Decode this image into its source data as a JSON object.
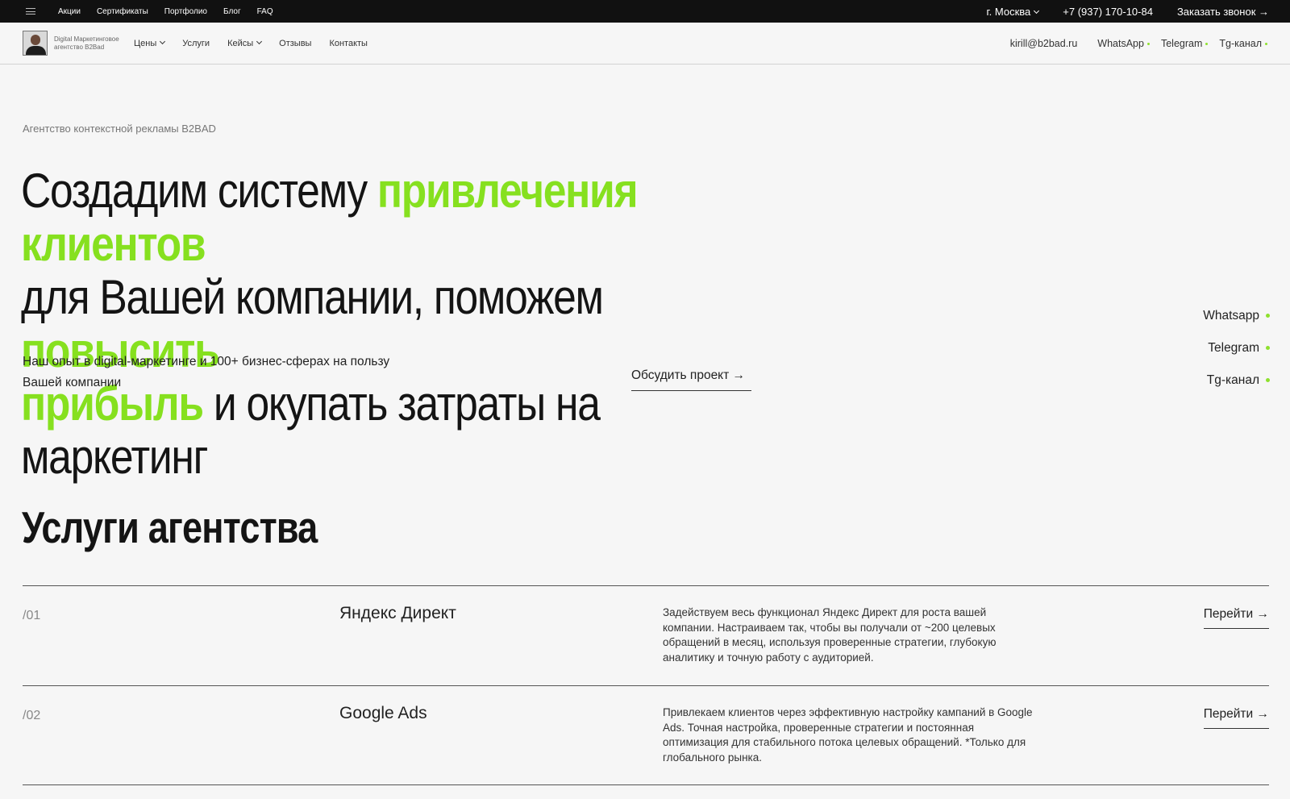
{
  "topbar": {
    "links": [
      "Акции",
      "Сертификаты",
      "Портфолио",
      "Блог",
      "FAQ"
    ],
    "city": "г. Москва",
    "phone": "+7 (937) 170-10-84",
    "callback": "Заказать звонок →"
  },
  "nav": {
    "brand": "Digital Маркетинговое агентство B2Bad",
    "items": [
      "Цены",
      "Услуги",
      "Кейсы",
      "Отзывы",
      "Контакты"
    ],
    "email": "kirill@b2bad.ru",
    "messengers": [
      "WhatsApp",
      "Telegram",
      "Tg-канал"
    ]
  },
  "hero": {
    "kicker": "Агентство контекстной рекламы B2BAD",
    "line1_a": "Создадим систему ",
    "line1_b": "привлечения клиентов",
    "line2_a": "для Вашей компании, поможем ",
    "line2_b": "повысить",
    "line3_a": "прибыль",
    "line3_b": " и окупать затраты на маркетинг",
    "sub1": "Наш опыт в digital-маркетинге и 100+ бизнес-сферах на пользу",
    "sub2": "Вашей компании",
    "cta": "Обсудить проект →"
  },
  "side": [
    "Whatsapp",
    "Telegram",
    "Tg-канал"
  ],
  "services": {
    "title": "Услуги агентства",
    "items": [
      {
        "num": "/01",
        "name": "Яндекс Директ",
        "desc": "Задействуем весь функционал Яндекс Директ для роста вашей компании. Настраиваем так, чтобы вы получали от ~200 целевых обращений в месяц, используя проверенные стратегии, глубокую аналитику и точную работу с аудиторией.",
        "link": "Перейти →"
      },
      {
        "num": "/02",
        "name": "Google Ads",
        "desc": "Привлекаем клиентов через эффективную настройку кампаний в Google Ads. Точная настройка, проверенные стратегии и постоянная оптимизация для стабильного потока целевых обращений. *Только для глобального рынка.",
        "link": "Перейти →"
      }
    ]
  },
  "colors": {
    "accent": "#86e01f",
    "topbar": "#111111",
    "background": "#f6f6f6"
  }
}
